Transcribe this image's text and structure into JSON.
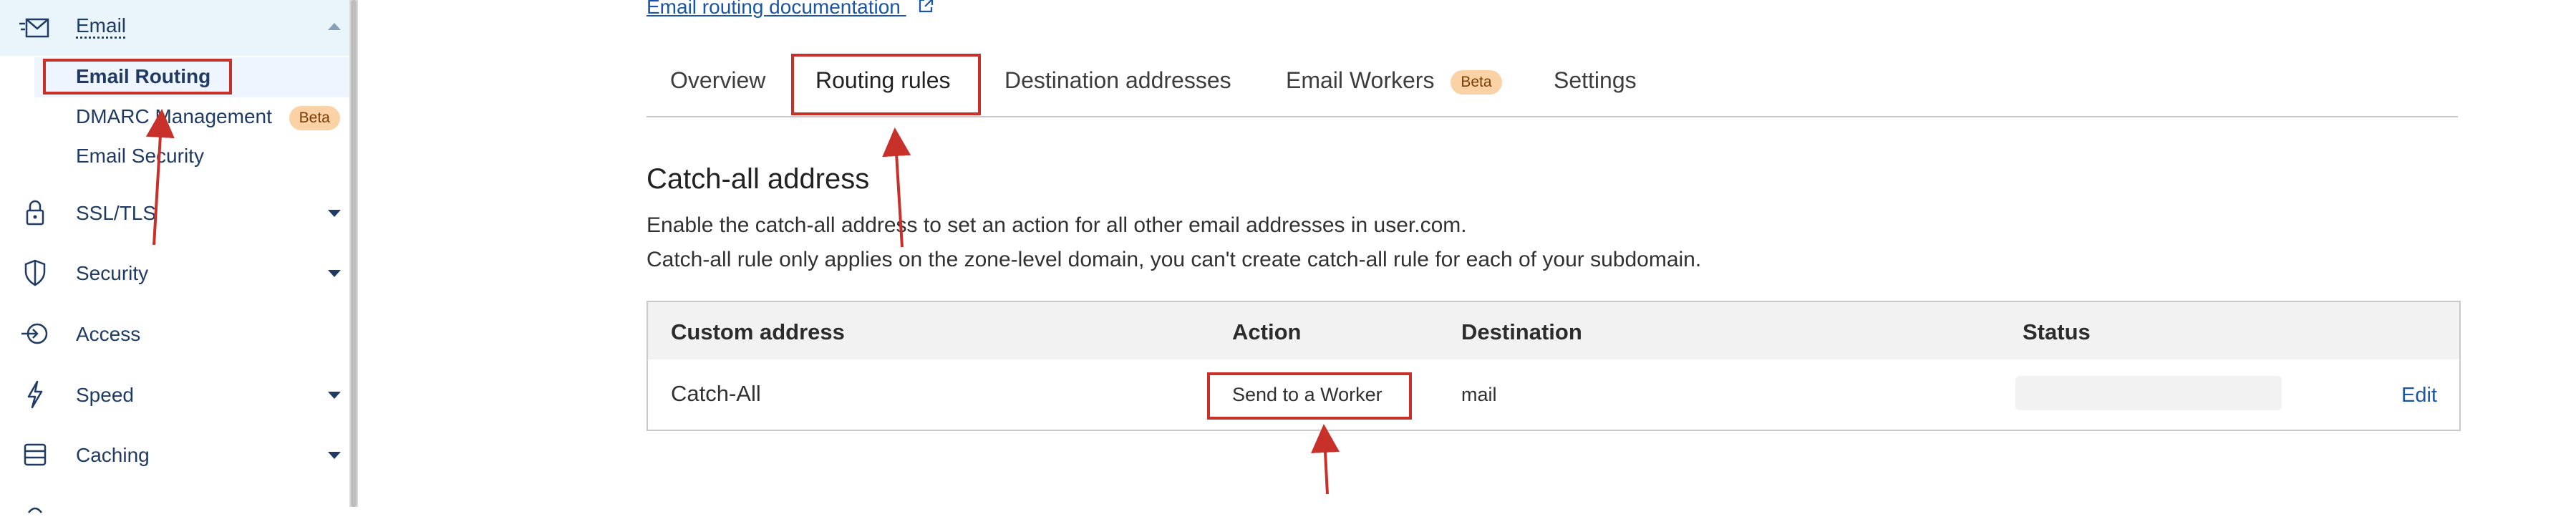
{
  "sidebar": {
    "email_label": "Email",
    "sub_items": {
      "email_routing": "Email Routing",
      "dmarc": "DMARC Management",
      "dmarc_badge": "Beta",
      "email_security": "Email Security"
    },
    "items": {
      "ssl": "SSL/TLS",
      "security": "Security",
      "access": "Access",
      "speed": "Speed",
      "caching": "Caching"
    }
  },
  "main": {
    "doc_link": "Email routing documentation",
    "tabs": {
      "overview": "Overview",
      "routing_rules": "Routing rules",
      "destination_addresses": "Destination addresses",
      "email_workers": "Email Workers",
      "email_workers_badge": "Beta",
      "settings": "Settings"
    },
    "section_title": "Catch-all address",
    "desc_line1": "Enable the catch-all address to set an action for all other email addresses in user.com.",
    "desc_line2": "Catch-all rule only applies on the zone-level domain, you can't create catch-all rule for each of your subdomain.",
    "table": {
      "headers": {
        "custom_address": "Custom address",
        "action": "Action",
        "destination": "Destination",
        "status": "Status"
      },
      "row": {
        "custom_address": "Catch-All",
        "action": "Send to a Worker",
        "destination": "mail",
        "edit": "Edit"
      }
    }
  },
  "colors": {
    "annotation_red": "#c8302a",
    "link_blue": "#1a56a8",
    "sidebar_text": "#1f3b63",
    "badge_bg": "#fbd2a6"
  }
}
